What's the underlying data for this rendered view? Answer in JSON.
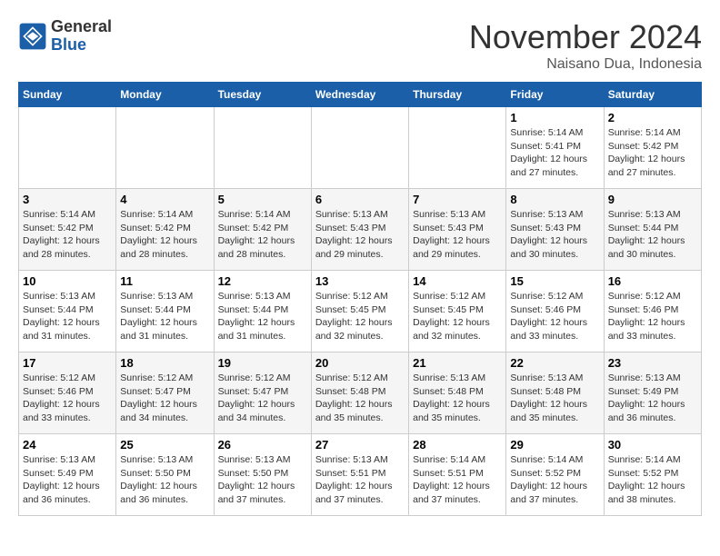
{
  "header": {
    "logo_general": "General",
    "logo_blue": "Blue",
    "month_title": "November 2024",
    "location": "Naisano Dua, Indonesia"
  },
  "weekdays": [
    "Sunday",
    "Monday",
    "Tuesday",
    "Wednesday",
    "Thursday",
    "Friday",
    "Saturday"
  ],
  "weeks": [
    [
      {
        "day": "",
        "info": ""
      },
      {
        "day": "",
        "info": ""
      },
      {
        "day": "",
        "info": ""
      },
      {
        "day": "",
        "info": ""
      },
      {
        "day": "",
        "info": ""
      },
      {
        "day": "1",
        "info": "Sunrise: 5:14 AM\nSunset: 5:41 PM\nDaylight: 12 hours\nand 27 minutes."
      },
      {
        "day": "2",
        "info": "Sunrise: 5:14 AM\nSunset: 5:42 PM\nDaylight: 12 hours\nand 27 minutes."
      }
    ],
    [
      {
        "day": "3",
        "info": "Sunrise: 5:14 AM\nSunset: 5:42 PM\nDaylight: 12 hours\nand 28 minutes."
      },
      {
        "day": "4",
        "info": "Sunrise: 5:14 AM\nSunset: 5:42 PM\nDaylight: 12 hours\nand 28 minutes."
      },
      {
        "day": "5",
        "info": "Sunrise: 5:14 AM\nSunset: 5:42 PM\nDaylight: 12 hours\nand 28 minutes."
      },
      {
        "day": "6",
        "info": "Sunrise: 5:13 AM\nSunset: 5:43 PM\nDaylight: 12 hours\nand 29 minutes."
      },
      {
        "day": "7",
        "info": "Sunrise: 5:13 AM\nSunset: 5:43 PM\nDaylight: 12 hours\nand 29 minutes."
      },
      {
        "day": "8",
        "info": "Sunrise: 5:13 AM\nSunset: 5:43 PM\nDaylight: 12 hours\nand 30 minutes."
      },
      {
        "day": "9",
        "info": "Sunrise: 5:13 AM\nSunset: 5:44 PM\nDaylight: 12 hours\nand 30 minutes."
      }
    ],
    [
      {
        "day": "10",
        "info": "Sunrise: 5:13 AM\nSunset: 5:44 PM\nDaylight: 12 hours\nand 31 minutes."
      },
      {
        "day": "11",
        "info": "Sunrise: 5:13 AM\nSunset: 5:44 PM\nDaylight: 12 hours\nand 31 minutes."
      },
      {
        "day": "12",
        "info": "Sunrise: 5:13 AM\nSunset: 5:44 PM\nDaylight: 12 hours\nand 31 minutes."
      },
      {
        "day": "13",
        "info": "Sunrise: 5:12 AM\nSunset: 5:45 PM\nDaylight: 12 hours\nand 32 minutes."
      },
      {
        "day": "14",
        "info": "Sunrise: 5:12 AM\nSunset: 5:45 PM\nDaylight: 12 hours\nand 32 minutes."
      },
      {
        "day": "15",
        "info": "Sunrise: 5:12 AM\nSunset: 5:46 PM\nDaylight: 12 hours\nand 33 minutes."
      },
      {
        "day": "16",
        "info": "Sunrise: 5:12 AM\nSunset: 5:46 PM\nDaylight: 12 hours\nand 33 minutes."
      }
    ],
    [
      {
        "day": "17",
        "info": "Sunrise: 5:12 AM\nSunset: 5:46 PM\nDaylight: 12 hours\nand 33 minutes."
      },
      {
        "day": "18",
        "info": "Sunrise: 5:12 AM\nSunset: 5:47 PM\nDaylight: 12 hours\nand 34 minutes."
      },
      {
        "day": "19",
        "info": "Sunrise: 5:12 AM\nSunset: 5:47 PM\nDaylight: 12 hours\nand 34 minutes."
      },
      {
        "day": "20",
        "info": "Sunrise: 5:12 AM\nSunset: 5:48 PM\nDaylight: 12 hours\nand 35 minutes."
      },
      {
        "day": "21",
        "info": "Sunrise: 5:13 AM\nSunset: 5:48 PM\nDaylight: 12 hours\nand 35 minutes."
      },
      {
        "day": "22",
        "info": "Sunrise: 5:13 AM\nSunset: 5:48 PM\nDaylight: 12 hours\nand 35 minutes."
      },
      {
        "day": "23",
        "info": "Sunrise: 5:13 AM\nSunset: 5:49 PM\nDaylight: 12 hours\nand 36 minutes."
      }
    ],
    [
      {
        "day": "24",
        "info": "Sunrise: 5:13 AM\nSunset: 5:49 PM\nDaylight: 12 hours\nand 36 minutes."
      },
      {
        "day": "25",
        "info": "Sunrise: 5:13 AM\nSunset: 5:50 PM\nDaylight: 12 hours\nand 36 minutes."
      },
      {
        "day": "26",
        "info": "Sunrise: 5:13 AM\nSunset: 5:50 PM\nDaylight: 12 hours\nand 37 minutes."
      },
      {
        "day": "27",
        "info": "Sunrise: 5:13 AM\nSunset: 5:51 PM\nDaylight: 12 hours\nand 37 minutes."
      },
      {
        "day": "28",
        "info": "Sunrise: 5:14 AM\nSunset: 5:51 PM\nDaylight: 12 hours\nand 37 minutes."
      },
      {
        "day": "29",
        "info": "Sunrise: 5:14 AM\nSunset: 5:52 PM\nDaylight: 12 hours\nand 37 minutes."
      },
      {
        "day": "30",
        "info": "Sunrise: 5:14 AM\nSunset: 5:52 PM\nDaylight: 12 hours\nand 38 minutes."
      }
    ]
  ]
}
